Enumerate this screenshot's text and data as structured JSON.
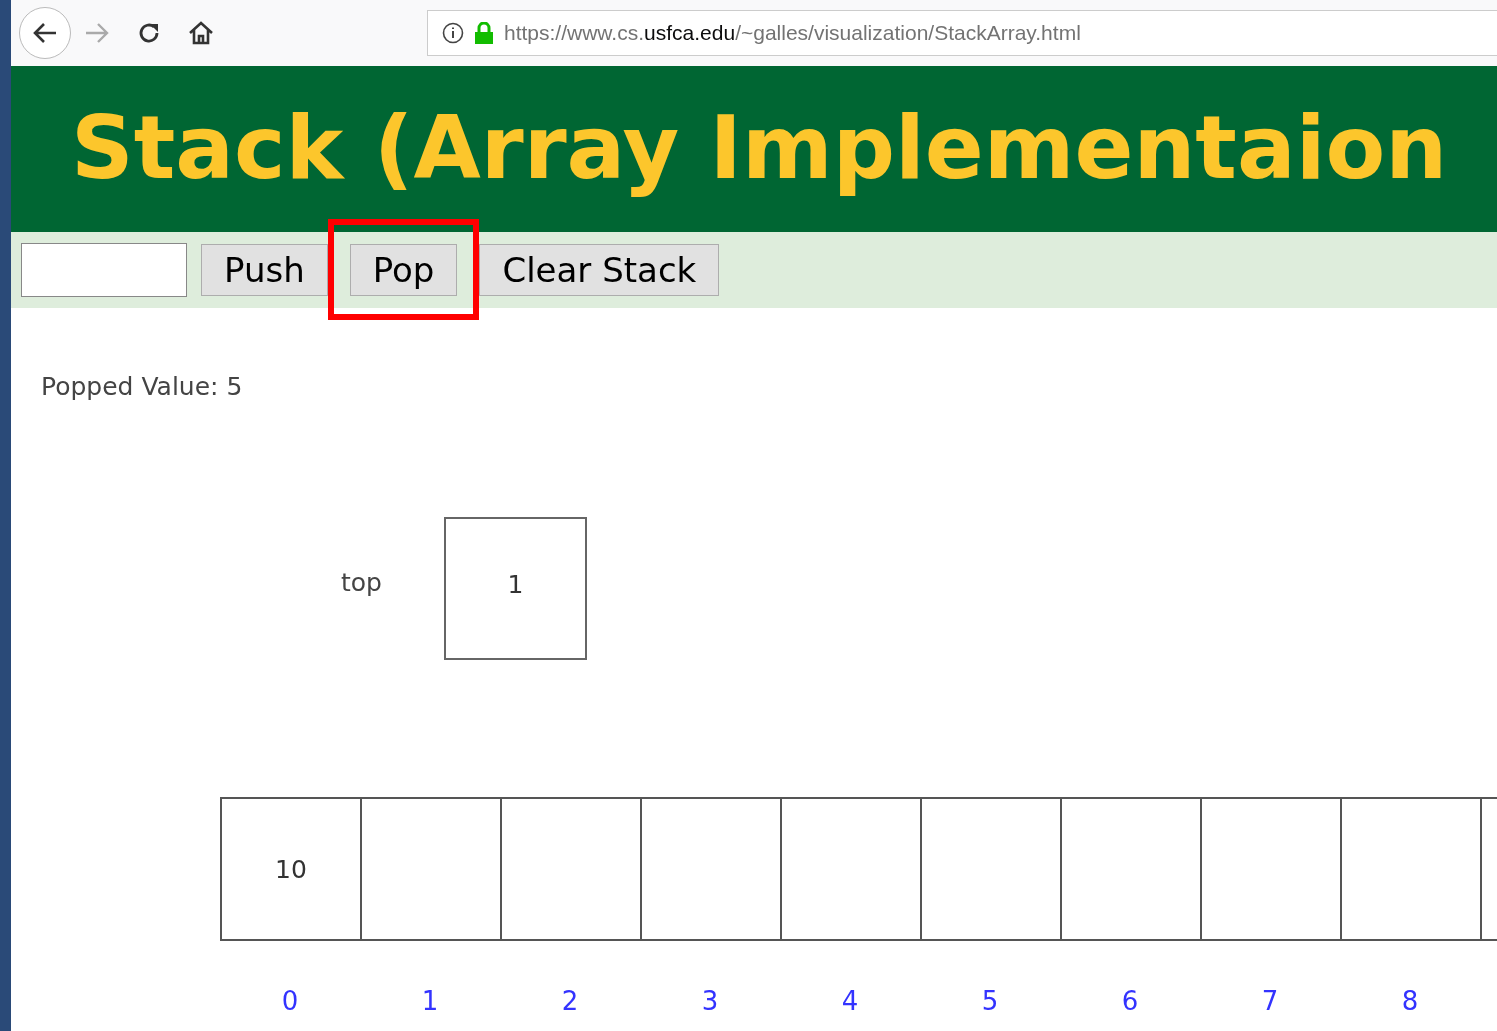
{
  "browser": {
    "url": "https://www.cs.**usfca.edu**/~galles/visualization/StackArray.html"
  },
  "header": {
    "title": "Stack (Array Implementaion"
  },
  "controls": {
    "buttons": [
      {
        "label": "Push",
        "highlighted": false
      },
      {
        "label": "Pop",
        "highlighted": true
      },
      {
        "label": "Clear Stack",
        "highlighted": false
      }
    ]
  },
  "canvas": {
    "message": "Popped Value: 5",
    "top": {
      "label": "top",
      "value": "1"
    },
    "cells": [
      {
        "value": "10",
        "index": "0"
      },
      {
        "index": "1"
      },
      {
        "index": "2"
      },
      {
        "index": "3"
      },
      {
        "index": "4"
      },
      {
        "index": "5"
      },
      {
        "index": "6"
      },
      {
        "index": "7"
      },
      {
        "index": "8"
      },
      {}
    ]
  }
}
